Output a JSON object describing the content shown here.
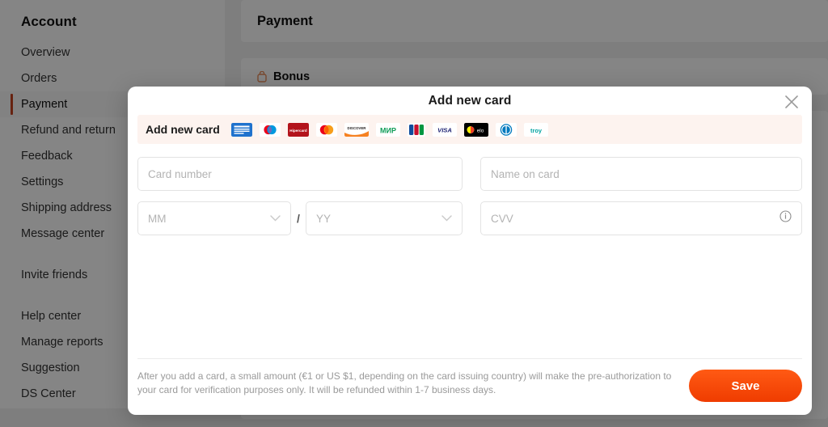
{
  "sidebar": {
    "title": "Account",
    "groups": [
      {
        "items": [
          {
            "label": "Overview",
            "active": false
          },
          {
            "label": "Orders",
            "active": false
          },
          {
            "label": "Payment",
            "active": true
          },
          {
            "label": "Refund and return",
            "active": false
          },
          {
            "label": "Feedback",
            "active": false
          },
          {
            "label": "Settings",
            "active": false
          },
          {
            "label": "Shipping address",
            "active": false
          },
          {
            "label": "Message center",
            "active": false
          }
        ]
      },
      {
        "items": [
          {
            "label": "Invite friends",
            "active": false
          }
        ]
      },
      {
        "items": [
          {
            "label": "Help center",
            "active": false
          },
          {
            "label": "Manage reports",
            "active": false
          },
          {
            "label": "Suggestion",
            "active": false
          },
          {
            "label": "DS Center",
            "active": false
          }
        ]
      }
    ]
  },
  "main": {
    "page_title": "Payment",
    "bonus_section": {
      "title": "Bonus",
      "icon": "coin-icon"
    }
  },
  "modal": {
    "title": "Add new card",
    "close_icon": "close-icon",
    "banner": {
      "label": "Add new card",
      "brands": [
        {
          "name": "american-express",
          "short": "AMEX"
        },
        {
          "name": "maestro",
          "short": ""
        },
        {
          "name": "hipercard",
          "short": "Hipercard"
        },
        {
          "name": "mastercard",
          "short": ""
        },
        {
          "name": "discover",
          "short": "DISCOVER"
        },
        {
          "name": "mir",
          "short": "МИР"
        },
        {
          "name": "jcb",
          "short": "JCB"
        },
        {
          "name": "visa",
          "short": "VISA"
        },
        {
          "name": "elo",
          "short": "elo"
        },
        {
          "name": "diners-club",
          "short": ""
        },
        {
          "name": "troy",
          "short": "troy"
        }
      ]
    },
    "fields": {
      "card_number": {
        "placeholder": "Card number",
        "value": ""
      },
      "name_on_card": {
        "placeholder": "Name on card",
        "value": ""
      },
      "expiry_month": {
        "placeholder": "MM",
        "value": ""
      },
      "expiry_year": {
        "placeholder": "YY",
        "value": ""
      },
      "cvv": {
        "placeholder": "CVV",
        "value": ""
      },
      "expiry_separator": "/"
    },
    "footer": {
      "note": "After you add a card, a small amount (€1 or US $1, depending on the card issuing country) will make the pre-authorization to your card for verification purposes only. It will be refunded within 1-7 business days.",
      "save_label": "Save"
    }
  },
  "colors": {
    "accent": "#ef3c00",
    "active_bar": "#c5411f",
    "banner_bg": "#fdf3ef"
  }
}
